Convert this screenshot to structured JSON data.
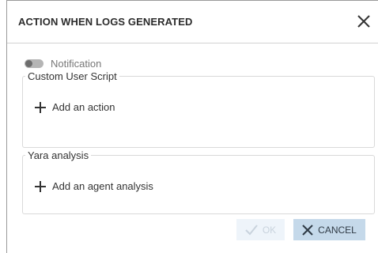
{
  "dialog": {
    "title": "ACTION WHEN LOGS GENERATED",
    "close_icon": "close-icon"
  },
  "notification": {
    "label": "Notification",
    "enabled": false
  },
  "custom_user_script": {
    "legend": "Custom User Script",
    "add_label": "Add an action",
    "add_icon": "plus-icon"
  },
  "yara_analysis": {
    "legend": "Yara analysis",
    "add_label": "Add an agent analysis",
    "add_icon": "plus-icon"
  },
  "footer": {
    "ok_label": "OK",
    "ok_icon": "check-icon",
    "ok_disabled": true,
    "cancel_label": "CANCEL",
    "cancel_icon": "close-icon"
  },
  "colors": {
    "cancel_bg": "#c5d9ea",
    "ok_bg_disabled": "#eef4fa",
    "border": "#d9d9d9"
  }
}
